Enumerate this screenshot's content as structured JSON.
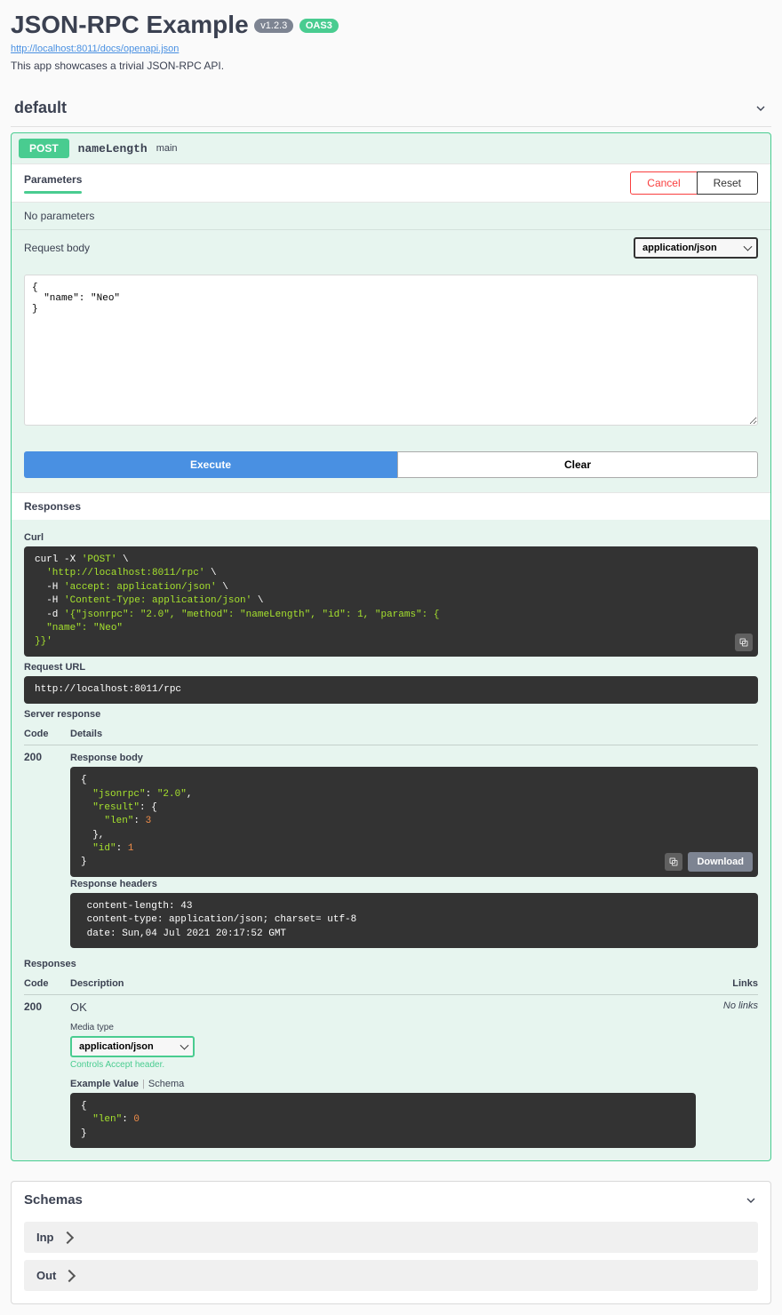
{
  "header": {
    "title": "JSON-RPC Example",
    "version": "v1.2.3",
    "oas": "OAS3",
    "api_url": "http://localhost:8011/docs/openapi.json",
    "description": "This app showcases a trivial JSON-RPC API."
  },
  "tag": {
    "name": "default"
  },
  "op": {
    "method": "POST",
    "path": "nameLength",
    "summary": "main",
    "parameters_tab": "Parameters",
    "cancel": "Cancel",
    "reset": "Reset",
    "no_params": "No parameters",
    "request_body_label": "Request body",
    "content_type": "application/json",
    "body_value": "{\n  \"name\": \"Neo\"\n}",
    "execute": "Execute",
    "clear": "Clear"
  },
  "responses": {
    "header": "Responses",
    "curl_label": "Curl",
    "curl_plain": "curl -X 'POST' \\\n  'http://localhost:8011/rpc' \\\n  -H 'accept: application/json' \\\n  -H 'Content-Type: application/json' \\\n  -d '{\"jsonrpc\": \"2.0\", \"method\": \"nameLength\", \"id\": 1, \"params\": {\n  \"name\": \"Neo\"\n}}'",
    "request_url_label": "Request URL",
    "request_url": "http://localhost:8011/rpc",
    "server_response_label": "Server response",
    "col_code": "Code",
    "col_details": "Details",
    "live": {
      "code": "200",
      "body_label": "Response body",
      "body": "{\n  \"jsonrpc\": \"2.0\",\n  \"result\": {\n    \"len\": 3\n  },\n  \"id\": 1\n}",
      "headers_label": "Response headers",
      "headers": " content-length: 43 \n content-type: application/json; charset= utf-8 \n date: Sun,04 Jul 2021 20:17:52 GMT ",
      "download": "Download"
    },
    "doc_label": "Responses",
    "col_desc": "Description",
    "col_links": "Links",
    "doc": {
      "code": "200",
      "desc": "OK",
      "media_label": "Media type",
      "media_type": "application/json",
      "media_hint": "Controls Accept header.",
      "example_tab": "Example Value",
      "schema_tab": "Schema",
      "example": "{\n  \"len\": 0\n}",
      "no_links": "No links"
    }
  },
  "schemas": {
    "header": "Schemas",
    "items": [
      "Inp",
      "Out"
    ]
  }
}
